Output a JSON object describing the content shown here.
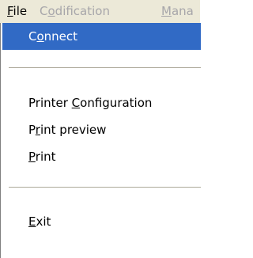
{
  "menubar": {
    "items": [
      {
        "prefix": "",
        "mnemonic": "F",
        "suffix": "ile",
        "state": "active"
      },
      {
        "prefix": "C",
        "mnemonic": "o",
        "suffix": "dification",
        "state": "disabled"
      },
      {
        "prefix": "",
        "mnemonic": "M",
        "suffix": "ana",
        "state": "disabled"
      }
    ]
  },
  "file_menu": {
    "items": [
      {
        "prefix": "C",
        "mnemonic": "o",
        "suffix": "nnect",
        "highlighted": true
      },
      {
        "prefix": "Printer ",
        "mnemonic": "C",
        "suffix": "onfiguration"
      },
      {
        "prefix": "P",
        "mnemonic": "r",
        "suffix": "int preview"
      },
      {
        "prefix": "",
        "mnemonic": "P",
        "suffix": "rint"
      },
      {
        "prefix": "",
        "mnemonic": "E",
        "suffix": "xit"
      }
    ]
  },
  "colors": {
    "menubar_bg": "#ece9d8",
    "highlight_bg": "#316ac5",
    "disabled_text": "#a7a6aa"
  }
}
